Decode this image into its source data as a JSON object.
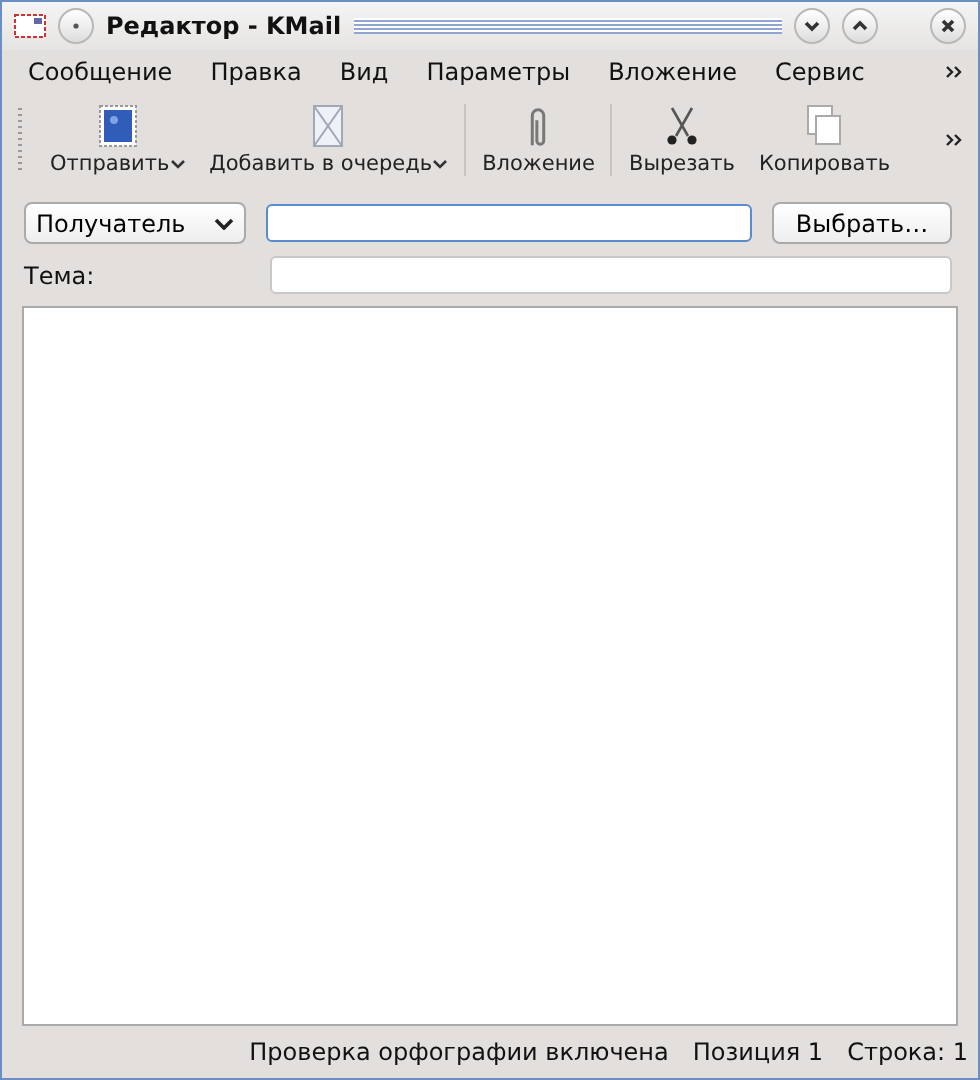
{
  "window": {
    "title": "Редактор - KMail"
  },
  "menu": [
    "Сообщение",
    "Правка",
    "Вид",
    "Параметры",
    "Вложение",
    "Сервис"
  ],
  "toolbar": [
    {
      "kind": "send",
      "label": "Отправить",
      "dropdown": true
    },
    {
      "kind": "queue",
      "label": "Добавить в очередь",
      "dropdown": true
    },
    {
      "kind": "attach",
      "label": "Вложение",
      "dropdown": false
    },
    {
      "kind": "cut",
      "label": "Вырезать",
      "dropdown": false
    },
    {
      "kind": "copy",
      "label": "Копировать",
      "dropdown": false
    }
  ],
  "recipient": {
    "type": "Получатель",
    "button": "Выбрать…"
  },
  "subject": {
    "label": "Тема:"
  },
  "status_bar": [
    "Проверка орфографии включена",
    "Позиция 1",
    "Строка: 1"
  ]
}
